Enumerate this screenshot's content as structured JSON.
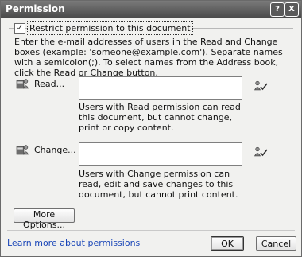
{
  "window": {
    "title": "Permission"
  },
  "title_buttons": {
    "help": "?",
    "close": "X"
  },
  "restrict": {
    "label": "Restrict permission to this document",
    "checked": true,
    "check_glyph": "✓"
  },
  "instructions": "Enter the e-mail addresses of users in the Read and Change boxes (example: 'someone@example.com'). Separate names with a semicolon(;). To select names from the Address book, click the Read or Change button.",
  "read": {
    "label": "Read...",
    "value": "",
    "help": "Users with Read permission can read this document, but cannot change, print or copy content."
  },
  "change": {
    "label": "Change...",
    "value": "",
    "help": "Users with Change permission can read, edit and save changes to this document, but cannot print content."
  },
  "buttons": {
    "more_options": "More Options...",
    "ok": "OK",
    "cancel": "Cancel"
  },
  "link": "Learn more about permissions",
  "icons": {
    "address_book": "people-icon",
    "check_names": "check-names-icon"
  }
}
